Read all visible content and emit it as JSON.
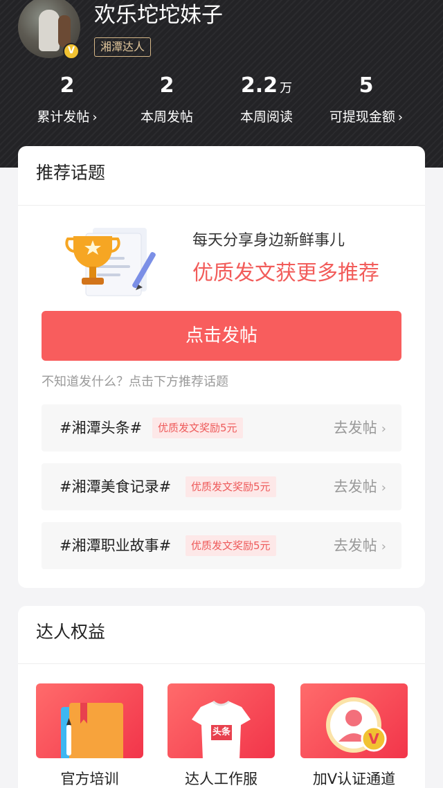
{
  "profile": {
    "nickname": "欢乐坨坨妹子",
    "tag": "湘潭达人",
    "verified_mark": "V"
  },
  "stats": [
    {
      "value": "2",
      "unit": "",
      "label": "累计发帖",
      "has_arrow": true
    },
    {
      "value": "2",
      "unit": "",
      "label": "本周发帖",
      "has_arrow": false
    },
    {
      "value": "2.2",
      "unit": "万",
      "label": "本周阅读",
      "has_arrow": false
    },
    {
      "value": "5",
      "unit": "",
      "label": "可提现金额",
      "has_arrow": true
    }
  ],
  "recommend": {
    "title": "推荐话题",
    "slogan_line1": "每天分享身边新鲜事儿",
    "slogan_line2": "优质发文获更多推荐",
    "post_button": "点击发帖",
    "hint": "不知道发什么？点击下方推荐话题",
    "topics": [
      {
        "name": "#湘潭头条#",
        "reward": "优质发文奖励5元",
        "action": "去发帖"
      },
      {
        "name": "#湘潭美食记录#",
        "reward": "优质发文奖励5元",
        "action": "去发帖"
      },
      {
        "name": "#湘潭职业故事#",
        "reward": "优质发文奖励5元",
        "action": "去发帖"
      }
    ]
  },
  "benefits": {
    "title": "达人权益",
    "items": [
      {
        "label": "官方培训",
        "icon": "books-icon"
      },
      {
        "label": "达人工作服",
        "icon": "tshirt-icon",
        "shirt_text": "头条"
      },
      {
        "label": "加V认证通道",
        "icon": "verified-user-icon",
        "badge_text": "V"
      }
    ]
  },
  "colors": {
    "header_bg": "#232326",
    "accent_red": "#f85d5d",
    "tag_gold": "#d7b889",
    "badge_yellow": "#f1c232"
  },
  "chevron": "›"
}
